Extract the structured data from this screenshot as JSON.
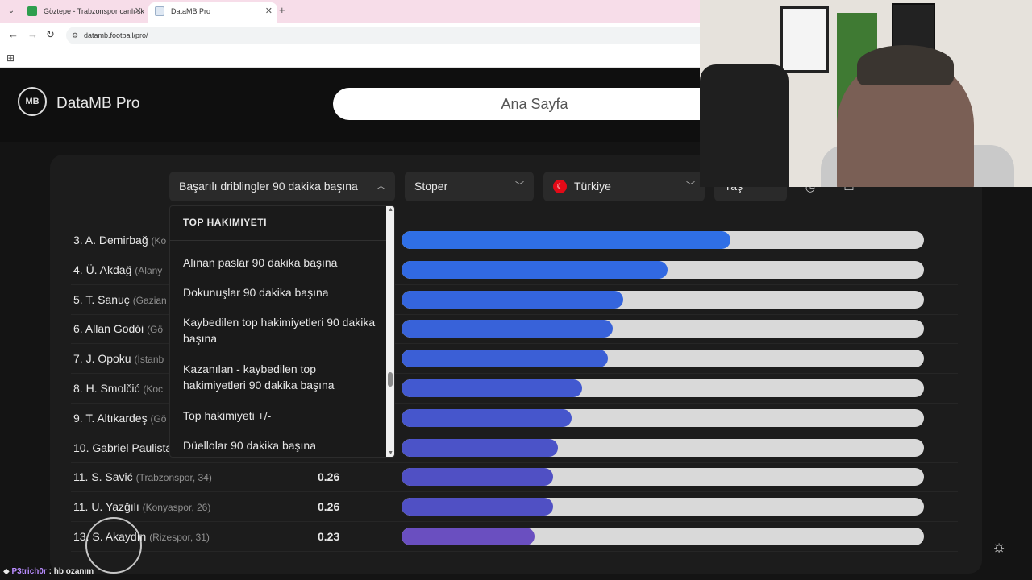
{
  "browser": {
    "tabs": [
      {
        "title": "Göztepe - Trabzonspor canlı sk"
      },
      {
        "title": "DataMB Pro"
      }
    ],
    "url": "datamb.football/pro/",
    "new_tab": "+",
    "close": "✕"
  },
  "site": {
    "brand": "DataMB Pro",
    "logo_text": "MB",
    "home_button": "Ana Sayfa"
  },
  "filters": {
    "metric": "Başarılı driblingler 90 dakika başına",
    "position": "Stoper",
    "country": "Türkiye",
    "age": "Yaş"
  },
  "dropdown": {
    "group_title": "TOP HAKIMIYETI",
    "items": [
      "Alınan paslar 90 dakika başına",
      "Dokunuşlar 90 dakika başına",
      "Kaybedilen top hakimiyetleri 90 dakika başına",
      "Kazanılan - kaybedilen top hakimiyetleri 90 dakika başına",
      "Top hakimiyeti +/-",
      "Düellolar 90 dakika başına"
    ]
  },
  "ranking": {
    "max_value": 0.84,
    "rows": [
      {
        "name": "3. A. Demirbağ",
        "club": "(Ko",
        "value": "",
        "fill": 0.63,
        "color": "#2f6fe6"
      },
      {
        "name": "4. Ü. Akdağ",
        "club": "(Alany",
        "value": "",
        "fill": 0.51,
        "color": "#3169e2"
      },
      {
        "name": "5. T. Sanuç",
        "club": "(Gazian",
        "value": "",
        "fill": 0.425,
        "color": "#3465dd"
      },
      {
        "name": "6. Allan Godói",
        "club": "(Gö",
        "value": "",
        "fill": 0.405,
        "color": "#3862d9"
      },
      {
        "name": "7. J. Opoku",
        "club": "(İstanb",
        "value": "",
        "fill": 0.395,
        "color": "#3b5fd6"
      },
      {
        "name": "8. H. Smolčić",
        "club": "(Koc",
        "value": "",
        "fill": 0.345,
        "color": "#4259d0"
      },
      {
        "name": "9. T. Altıkardeş",
        "club": "(Gö",
        "value": "",
        "fill": 0.325,
        "color": "#4656cc"
      },
      {
        "name": "10. Gabriel Paulista",
        "club": "",
        "value": "",
        "fill": 0.3,
        "color": "#4b53c8"
      },
      {
        "name": "11. S. Savić",
        "club": "(Trabzonspor, 34)",
        "value": "0.26",
        "fill": 0.29,
        "color": "#5050c4"
      },
      {
        "name": "11. U. Yazğılı",
        "club": "(Konyaspor, 26)",
        "value": "0.26",
        "fill": 0.29,
        "color": "#5050c4"
      },
      {
        "name": "13. S. Akaydın",
        "club": "(Rizespor, 31)",
        "value": "0.23",
        "fill": 0.255,
        "color": "#6a4fc0"
      }
    ]
  },
  "chat": {
    "user": "P3trich0r",
    "message": ": hb ozanım"
  }
}
